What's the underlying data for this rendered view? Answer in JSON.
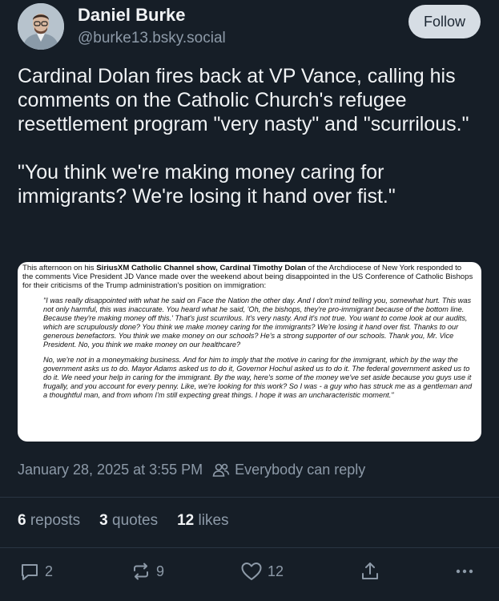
{
  "author": {
    "display_name": "Daniel Burke",
    "handle": "@burke13.bsky.social",
    "avatar_icon": "avatar-photo"
  },
  "follow_label": "Follow",
  "post": {
    "paragraph_1": "Cardinal Dolan fires back at VP Vance, calling his comments on the Catholic Church's refugee resettlement program \"very nasty\" and \"scurrilous.\"",
    "paragraph_2": "\"You think we're making money caring for immigrants? We're losing it hand over fist.\""
  },
  "embed": {
    "intro_a": "This afternoon on his ",
    "intro_bold": "SiriusXM Catholic Channel show, Cardinal Timothy Dolan",
    "intro_b": " of the Archdiocese of New York responded to the comments Vice President JD Vance made over the weekend about being disappointed in the US Conference of Catholic Bishops for their criticisms of the Trump administration's position on immigration:",
    "quote_1": "\"I was really disappointed with what he said on Face the Nation the other day. And I don't mind telling you, somewhat hurt. This was not only harmful, this was inaccurate. You heard what he said, 'Oh, the bishops, they're pro-immigrant because of the bottom line. Because they're making money off this.' That's just scurrilous. It's very nasty. And it's not true. You want to come look at our audits, which are scrupulously done? You think we make money caring for the immigrants? We're losing it hand over fist. Thanks to our generous benefactors. You think we make money on our schools? He's a strong supporter of our schools. Thank you, Mr. Vice President. No, you think we make money on our healthcare?",
    "quote_2": "No, we're not in a moneymaking business. And for him to imply that the motive in caring for the immigrant, which by the way the government asks us to do. Mayor Adams asked us to do it, Governor Hochul asked us to do it. The federal government asked us to do it. We need your help in caring for the immigrant. By the way, here's some of the money we've set aside because you guys use it frugally, and you account for every penny. Like, we're looking for this work? So I was - a guy who has struck me as a gentleman and a thoughtful man, and from whom I'm still expecting great things. I hope it was an uncharacteristic moment.\""
  },
  "meta": {
    "timestamp": "January 28, 2025 at 3:55 PM",
    "reply_setting": "Everybody can reply",
    "reply_icon": "people-icon"
  },
  "stats": {
    "reposts_count": "6",
    "reposts_label": "reposts",
    "quotes_count": "3",
    "quotes_label": "quotes",
    "likes_count": "12",
    "likes_label": "likes"
  },
  "actions": {
    "reply_count": "2",
    "repost_count": "9",
    "like_count": "12"
  },
  "colors": {
    "background": "#161e27",
    "text": "#f1f3f5",
    "muted": "#8d9aa8",
    "follow_bg": "#d6dde4"
  }
}
